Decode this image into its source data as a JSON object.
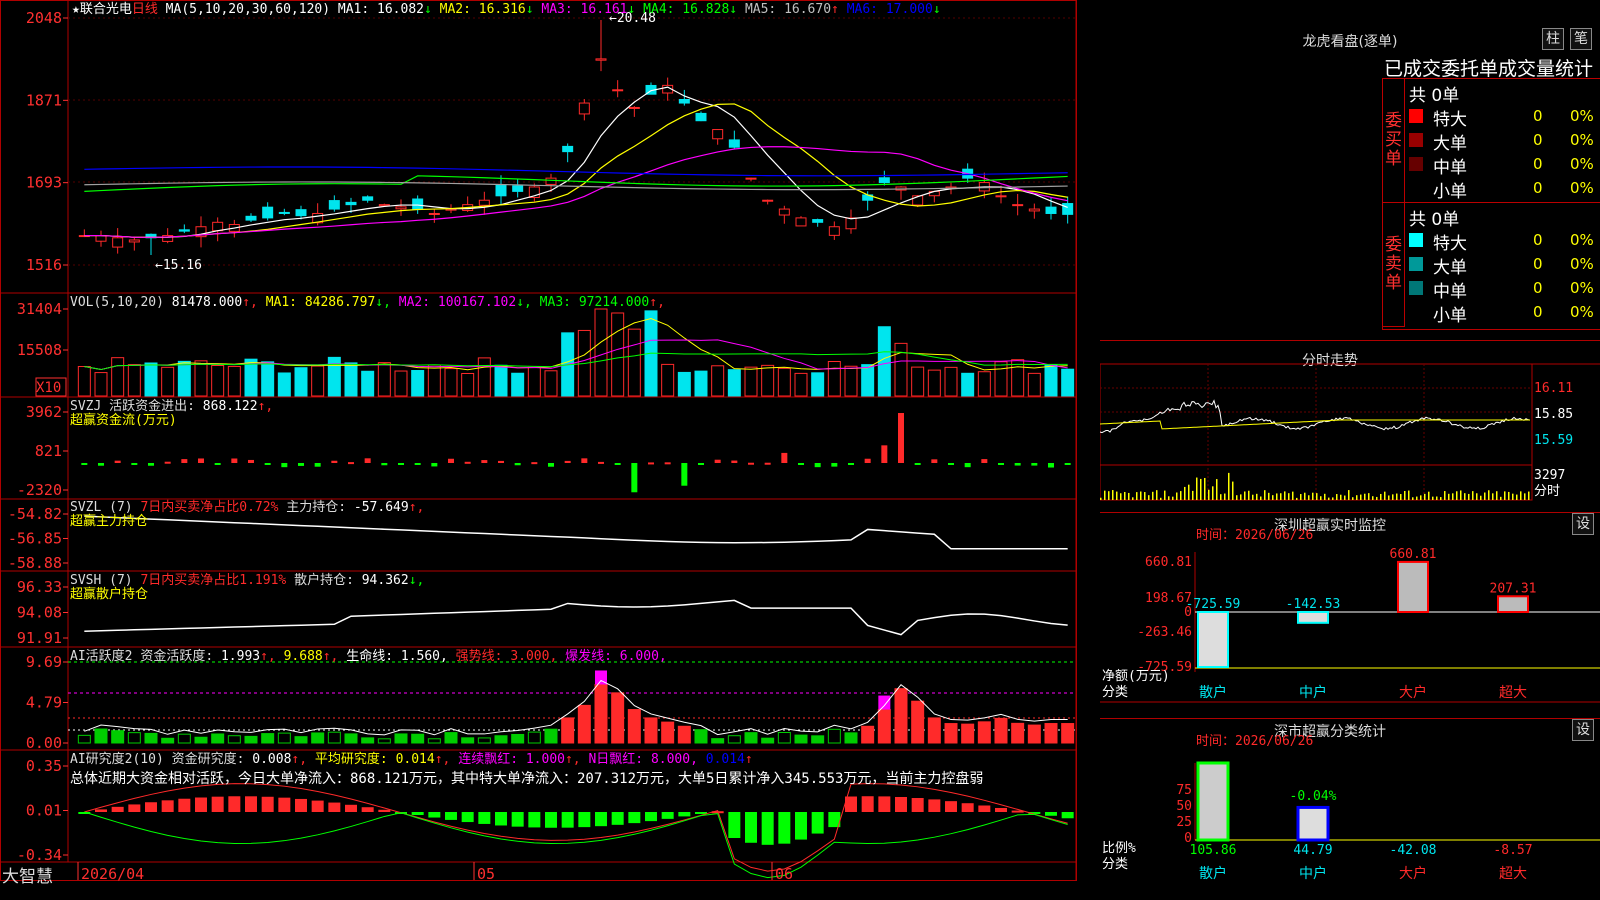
{
  "colors": {
    "up": "#ff2a2a",
    "down": "#00e5ee",
    "grid": "#b00000",
    "axis": "#ff3030",
    "ma1": "#ffffff",
    "ma2": "#ffff00",
    "ma3": "#ff00ff",
    "ma4": "#00ff00",
    "ma5": "#a0a0a0",
    "ma6": "#0000ff",
    "bright_green": "#00ff00",
    "label_yellow": "#ffff00"
  },
  "panel1": {
    "name": "联合光电",
    "period": "日线",
    "ma_params": "MA(5,10,20,30,60,120)",
    "ma": [
      {
        "label": "MA1:",
        "value": "16.082",
        "arrow": "↓",
        "color": "#ffffff"
      },
      {
        "label": "MA2:",
        "value": "16.316",
        "arrow": "↓",
        "color": "#ffff00"
      },
      {
        "label": "MA3:",
        "value": "16.161",
        "arrow": "↓",
        "color": "#ff00ff"
      },
      {
        "label": "MA4:",
        "value": "16.828",
        "arrow": "↓",
        "color": "#00ff00"
      },
      {
        "label": "MA5:",
        "value": "16.670",
        "arrow": "↑",
        "color": "#c0c0c0"
      },
      {
        "label": "MA6:",
        "value": "17.000",
        "arrow": "↓",
        "color": "#0000ff"
      }
    ],
    "y_ticks": [
      "2048",
      "1871",
      "1693",
      "1516"
    ],
    "high_label": "20.48",
    "low_label": "15.16"
  },
  "panel2": {
    "title": "VOL(5,10,20)",
    "value": "81478.000",
    "arrow": "↑",
    "ma": [
      {
        "label": "MA1:",
        "value": "84286.797",
        "arrow": "↓",
        "color": "#ffff00"
      },
      {
        "label": "MA2:",
        "value": "100167.102",
        "arrow": "↓",
        "color": "#ff00ff"
      },
      {
        "label": "MA3:",
        "value": "97214.000",
        "arrow": "↑",
        "color": "#00ff00"
      }
    ],
    "y_ticks": [
      "31404",
      "15508"
    ],
    "unit": "X10"
  },
  "panel3": {
    "title": "SVZJ",
    "label": "活跃资金进出:",
    "value": "868.122",
    "arrow": "↑",
    "sub": "超赢资金流(万元)",
    "y_ticks": [
      "3962",
      "821",
      "-2320"
    ]
  },
  "panel4": {
    "title": "SVZL (7)",
    "label_red": "7日内买卖净占比0.72%",
    "label": "主力持仓:",
    "value": "-57.649",
    "arrow": "↑",
    "sub": "超赢主力持仓",
    "y_ticks": [
      "-54.82",
      "-56.85",
      "-58.88"
    ]
  },
  "panel5": {
    "title": "SVSH (7)",
    "label_red": "7日内买卖净占比1.191%",
    "label": "散户持仓:",
    "value": "94.362",
    "arrow": "↓",
    "sub": "超赢散户持仓",
    "y_ticks": [
      "96.33",
      "94.08",
      "91.91"
    ]
  },
  "panel6": {
    "title": "AI活跃度2",
    "label": "资金活跃度:",
    "value": "1.993",
    "arrow": "↑",
    "value2": "9.688",
    "label3": "生命线:",
    "value3": "1.560",
    "label4": "强势线:",
    "value4": "3.000",
    "label5": "爆发线:",
    "value5": "6.000",
    "y_ticks": [
      "9.69",
      "4.79",
      "0.00"
    ]
  },
  "panel7": {
    "title": "AI研究度2(10)",
    "label": "资金研究度:",
    "value": "0.008",
    "arrow": "↑",
    "label2": "平均研究度:",
    "value2": "0.014",
    "label3": "连续飘红:",
    "value3": "1.000",
    "label4": "N日飘红:",
    "value4": "8.000",
    "value5": "0.014",
    "summary": "总体近期大资金相对活跃，今日大单净流入：868.121万元，其中特大单净流入：207.312万元，大单5日累计净入345.553万元，当前主力控盘弱",
    "y_ticks": [
      "0.35",
      "0.01",
      "-0.34"
    ]
  },
  "xaxis": {
    "brand": "大智慧",
    "labels": [
      "2026/04",
      "05",
      "06"
    ]
  },
  "side": {
    "lhb": {
      "title": "龙虎看盘(逐单)",
      "btn1": "柱",
      "btn2": "笔",
      "header": "已成交委托单成交量统计",
      "buy": {
        "side_label": "委买单",
        "total": "共 0单",
        "rows": [
          {
            "name": "特大",
            "n": "0",
            "p": "0%",
            "color": "#ff0000"
          },
          {
            "name": "大单",
            "n": "0",
            "p": "0%",
            "color": "#990000"
          },
          {
            "name": "中单",
            "n": "0",
            "p": "0%",
            "color": "#660000"
          },
          {
            "name": "小单",
            "n": "0",
            "p": "0%",
            "color": ""
          }
        ]
      },
      "sell": {
        "side_label": "委卖单",
        "total": "共 0单",
        "rows": [
          {
            "name": "特大",
            "n": "0",
            "p": "0%",
            "color": "#00ffff"
          },
          {
            "name": "大单",
            "n": "0",
            "p": "0%",
            "color": "#009999"
          },
          {
            "name": "中单",
            "n": "0",
            "p": "0%",
            "color": "#007777"
          },
          {
            "name": "小单",
            "n": "0",
            "p": "0%",
            "color": ""
          }
        ]
      }
    },
    "fenshi": {
      "title": "分时走势",
      "y_ticks": [
        "16.11",
        "15.85",
        "15.59"
      ],
      "vol": "3297",
      "vol_label": "分时"
    },
    "sz": {
      "title": "深圳超赢实时监控",
      "btn": "设",
      "time": "时间：2026/06/26",
      "y_ticks": [
        "660.81",
        "198.67",
        "0",
        "-263.46",
        "-725.59"
      ],
      "net_label": "净额(万元)",
      "cat_label": "分类",
      "bars": [
        {
          "name": "散户",
          "value": "-725.59",
          "v": -725.59,
          "color": "#00ffff"
        },
        {
          "name": "中户",
          "value": "-142.53",
          "v": -142.53,
          "color": "#00ffff"
        },
        {
          "name": "大户",
          "value": "660.81",
          "v": 660.81,
          "color": "#ff0000"
        },
        {
          "name": "超大",
          "value": "207.31",
          "v": 207.31,
          "color": "#ff0000"
        }
      ]
    },
    "sc": {
      "title": "深市超赢分类统计",
      "btn": "设",
      "time": "时间：2026/06/26",
      "y_ticks": [
        "75",
        "50",
        "25",
        "0"
      ],
      "ratio_label": "比例%",
      "cat_label": "分类",
      "bar_label": "-0.04%",
      "bars": [
        {
          "name": "散户",
          "value": "105.86",
          "v": 105.86,
          "color": "#00ff00"
        },
        {
          "name": "中户",
          "value": "44.79",
          "v": 44.79,
          "color": "#0000ff"
        },
        {
          "name": "大户",
          "value": "-42.08",
          "v": -42.08,
          "color": "#00ffff"
        },
        {
          "name": "超大",
          "value": "-8.57",
          "v": -8.57,
          "color": "#ff0000"
        }
      ]
    }
  }
}
